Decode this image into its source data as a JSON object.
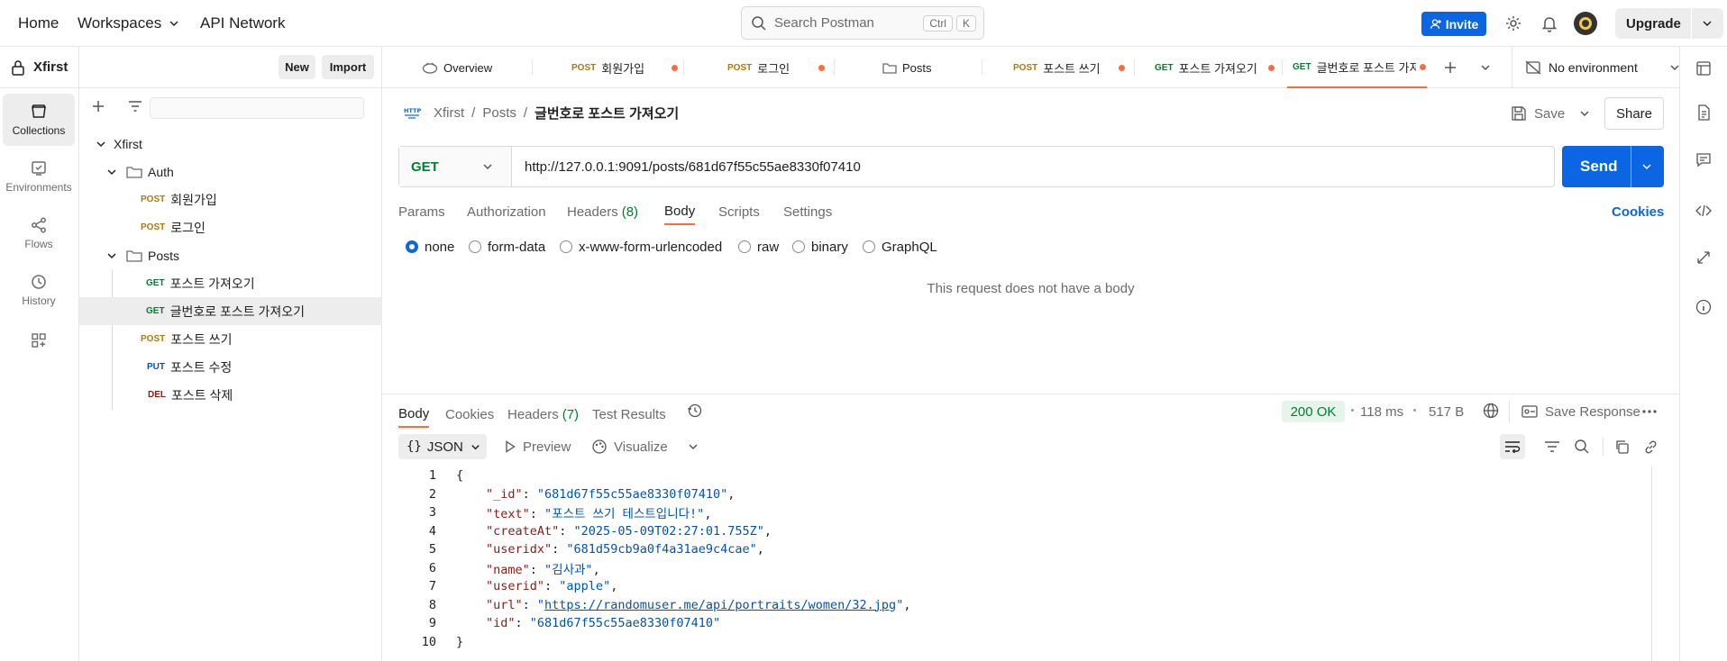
{
  "topbar": {
    "home": "Home",
    "workspaces": "Workspaces",
    "api_network": "API Network",
    "search_placeholder": "Search Postman",
    "kbd_ctrl": "Ctrl",
    "kbd_k": "K",
    "invite": "Invite",
    "upgrade": "Upgrade"
  },
  "workspace": {
    "name": "Xfirst",
    "new_label": "New",
    "import_label": "Import"
  },
  "rail": [
    {
      "label": "Collections",
      "icon": "collections-icon"
    },
    {
      "label": "Environments",
      "icon": "environments-icon"
    },
    {
      "label": "Flows",
      "icon": "flows-icon"
    },
    {
      "label": "History",
      "icon": "history-icon"
    }
  ],
  "tree": {
    "collection": "Xfirst",
    "folders": [
      {
        "name": "Auth",
        "items": [
          {
            "method": "POST",
            "name": "회원가입"
          },
          {
            "method": "POST",
            "name": "로그인"
          }
        ]
      },
      {
        "name": "Posts",
        "items": [
          {
            "method": "GET",
            "name": "포스트 가져오기"
          },
          {
            "method": "GET",
            "name": "글번호로 포스트 가져오기"
          },
          {
            "method": "POST",
            "name": "포스트 쓰기"
          },
          {
            "method": "PUT",
            "name": "포스트 수정"
          },
          {
            "method": "DEL",
            "name": "포스트 삭제"
          }
        ]
      }
    ]
  },
  "tabs": [
    {
      "method": "",
      "label": "Overview"
    },
    {
      "method": "POST",
      "label": "회원가입"
    },
    {
      "method": "POST",
      "label": "로그인"
    },
    {
      "method": "",
      "label": "Posts"
    },
    {
      "method": "POST",
      "label": "포스트 쓰기"
    },
    {
      "method": "GET",
      "label": "포스트 가져오기"
    },
    {
      "method": "GET",
      "label": "글번호로 포스트 가져오기"
    }
  ],
  "environment": "No environment",
  "breadcrumb": {
    "badge": "HTTP",
    "collection": "Xfirst",
    "folder": "Posts",
    "request": "글번호로 포스트 가져오기",
    "sep": "/"
  },
  "request_actions": {
    "save": "Save",
    "share": "Share"
  },
  "request": {
    "method": "GET",
    "url": "http://127.0.0.1:9091/posts/681d67f55c55ae8330f07410",
    "send": "Send"
  },
  "request_tabs": {
    "params": "Params",
    "authorization": "Authorization",
    "headers": "Headers",
    "headers_count": "(8)",
    "body": "Body",
    "scripts": "Scripts",
    "settings": "Settings",
    "cookies": "Cookies"
  },
  "body_types": [
    "none",
    "form-data",
    "x-www-form-urlencoded",
    "raw",
    "binary",
    "GraphQL"
  ],
  "no_body_text": "This request does not have a body",
  "response": {
    "tabs": {
      "body": "Body",
      "cookies": "Cookies",
      "headers": "Headers",
      "headers_count": "(7)",
      "test_results": "Test Results"
    },
    "status": "200 OK",
    "time": "118 ms",
    "size": "517 B",
    "save_response": "Save Response",
    "format": "JSON",
    "preview": "Preview",
    "visualize": "Visualize"
  },
  "code": {
    "line_numbers": [
      "1",
      "2",
      "3",
      "4",
      "5",
      "6",
      "7",
      "8",
      "9",
      "10"
    ],
    "open": "{",
    "close": "}",
    "fields": [
      {
        "key": "\"_id\"",
        "value": "\"681d67f55c55ae8330f07410\"",
        "comma": ","
      },
      {
        "key": "\"text\"",
        "value": "\"포스트 쓰기 테스트입니다!\"",
        "comma": ","
      },
      {
        "key": "\"createAt\"",
        "value": "\"2025-05-09T02:27:01.755Z\"",
        "comma": ","
      },
      {
        "key": "\"useridx\"",
        "value": "\"681d59cb9a0f4a31ae9c4cae\"",
        "comma": ","
      },
      {
        "key": "\"name\"",
        "value": "\"김사과\"",
        "comma": ","
      },
      {
        "key": "\"userid\"",
        "value": "\"apple\"",
        "comma": ","
      },
      {
        "key": "\"url\"",
        "value_link": "https://randomuser.me/api/portraits/women/32.jpg",
        "comma": ","
      },
      {
        "key": "\"id\"",
        "value": "\"681d67f55c55ae8330f07410\"",
        "comma": ""
      }
    ]
  },
  "colors": {
    "accent": "#ff6c37",
    "primary": "#0c66e4",
    "get": "#007f31",
    "post": "#ad7a03",
    "put": "#0053b8",
    "del": "#8e1a10"
  }
}
